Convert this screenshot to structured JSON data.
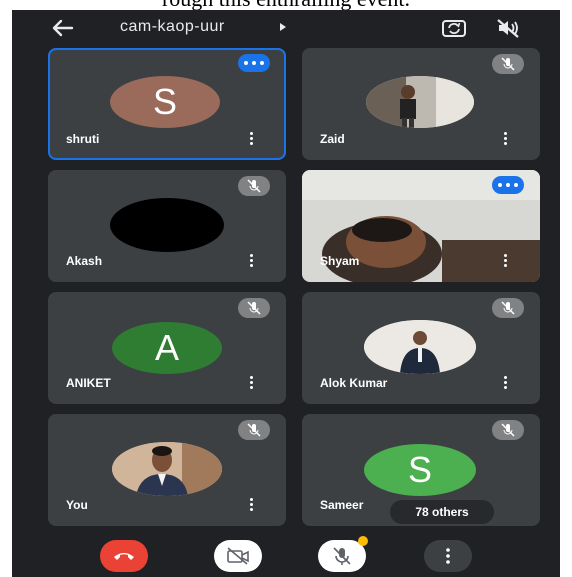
{
  "caption": "rough this enthralling event.",
  "header": {
    "meeting_code": "cam-kaop-uur",
    "icons": [
      "back-arrow-icon",
      "switch-camera-icon",
      "speaker-off-icon"
    ]
  },
  "participants": [
    {
      "name": "shruti",
      "avatar_letter": "S",
      "avatar_color": "#9a6a5a",
      "speaking": true,
      "active": true
    },
    {
      "name": "Zaid",
      "avatar_type": "photo",
      "muted": true
    },
    {
      "name": "Akash",
      "avatar_color": "#000000",
      "muted": true
    },
    {
      "name": "Shyam",
      "avatar_type": "video",
      "speaking": true
    },
    {
      "name": "ANIKET",
      "avatar_letter": "A",
      "avatar_color": "#2e7d32",
      "muted": true
    },
    {
      "name": "Alok Kumar",
      "avatar_type": "photo",
      "muted": true
    },
    {
      "name": "You",
      "avatar_type": "photo",
      "muted": true
    },
    {
      "name": "Sameer",
      "avatar_letter": "S",
      "avatar_color": "#4caf50",
      "muted": true
    }
  ],
  "others_label": "78 others",
  "controls": {
    "end_call_color": "#ea4335",
    "icons": [
      "end-call-icon",
      "camera-off-icon",
      "mic-off-icon",
      "more-options-icon"
    ]
  },
  "colors": {
    "background": "#202124",
    "tile": "#3c4043",
    "accent": "#1a73e8"
  }
}
